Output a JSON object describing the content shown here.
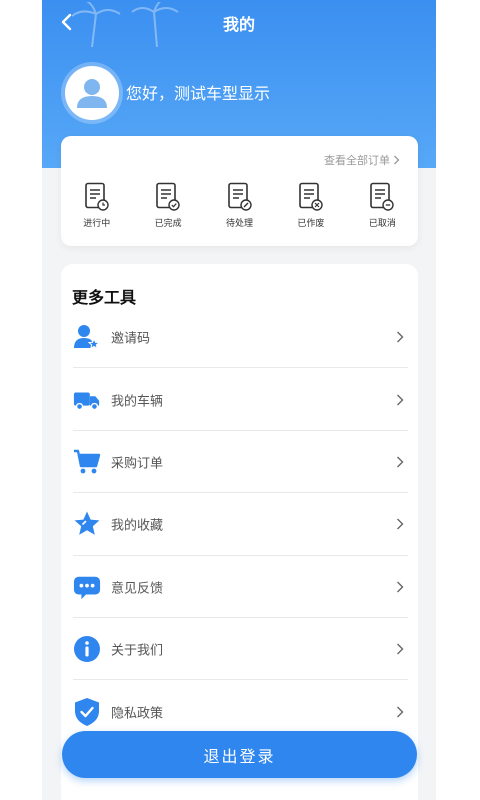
{
  "header": {
    "title": "我的",
    "greeting": "您好，测试车型显示"
  },
  "orders": {
    "view_all": "查看全部订单",
    "items": [
      {
        "label": "进行中",
        "icon": "doc-progress-icon"
      },
      {
        "label": "已完成",
        "icon": "doc-check-icon"
      },
      {
        "label": "待处理",
        "icon": "doc-pending-icon"
      },
      {
        "label": "已作废",
        "icon": "doc-void-icon"
      },
      {
        "label": "已取消",
        "icon": "doc-cancel-icon"
      }
    ]
  },
  "tools": {
    "title": "更多工具",
    "items": [
      {
        "label": "邀请码",
        "icon": "user-star-icon"
      },
      {
        "label": "我的车辆",
        "icon": "truck-icon"
      },
      {
        "label": "采购订单",
        "icon": "cart-icon"
      },
      {
        "label": "我的收藏",
        "icon": "star-icon"
      },
      {
        "label": "意见反馈",
        "icon": "chat-icon"
      },
      {
        "label": "关于我们",
        "icon": "info-icon"
      },
      {
        "label": "隐私政策",
        "icon": "shield-check-icon"
      }
    ]
  },
  "logout_label": "退出登录",
  "colors": {
    "brand": "#2f86ee",
    "header_top": "#3b8ff0",
    "header_bottom": "#57a8f7"
  }
}
